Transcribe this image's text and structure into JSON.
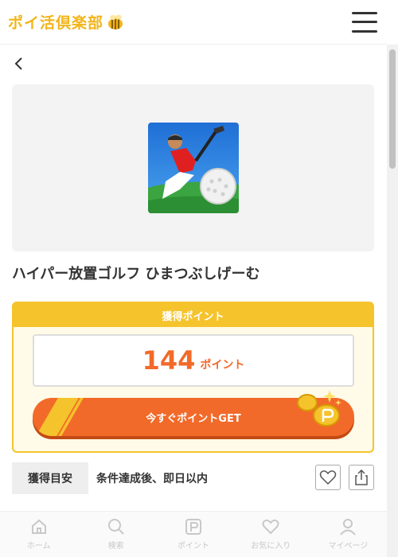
{
  "header": {
    "logo_text": "ポイ活倶楽部"
  },
  "offer": {
    "title": "ハイパー放置ゴルフ ひまつぶしげーむ",
    "point_header": "獲得ポイント",
    "points": "144",
    "point_unit": "ポイント",
    "get_button": "今すぐポイントGET"
  },
  "guide": {
    "label": "獲得目安",
    "text": "条件達成後、即日以内"
  },
  "nav": [
    {
      "label": "ホーム",
      "icon": "home-icon"
    },
    {
      "label": "検索",
      "icon": "search-icon"
    },
    {
      "label": "ポイント",
      "icon": "point-icon"
    },
    {
      "label": "お気に入り",
      "icon": "heart-icon"
    },
    {
      "label": "マイページ",
      "icon": "user-icon"
    }
  ],
  "colors": {
    "accent": "#f26a2a",
    "brand": "#f5c32c",
    "logo": "#f2b418"
  }
}
